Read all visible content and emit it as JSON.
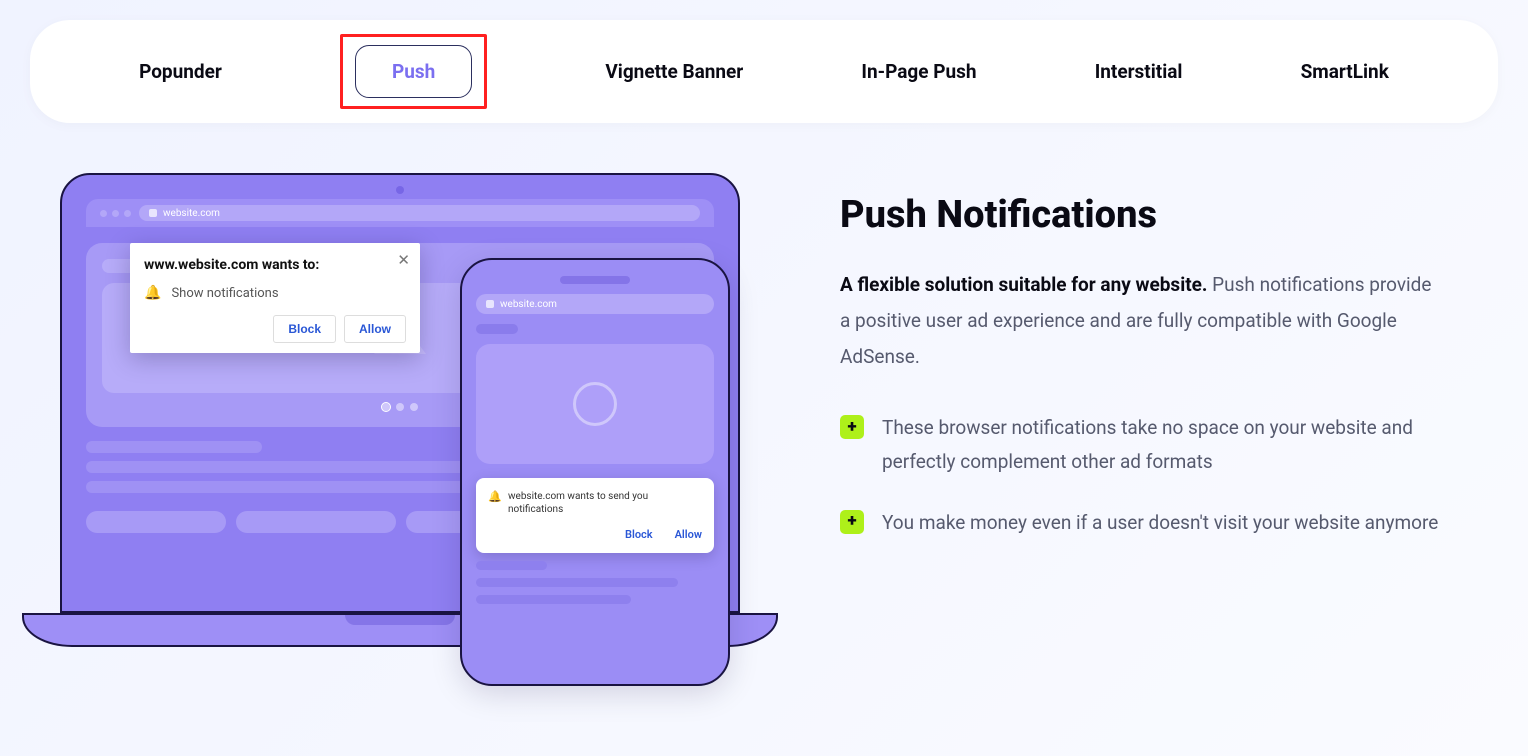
{
  "tabs": {
    "items": [
      {
        "label": "Popunder",
        "active": false
      },
      {
        "label": "Push",
        "active": true
      },
      {
        "label": "Vignette Banner",
        "active": false
      },
      {
        "label": "In-Page Push",
        "active": false
      },
      {
        "label": "Interstitial",
        "active": false
      },
      {
        "label": "SmartLink",
        "active": false
      }
    ]
  },
  "illustration": {
    "browser_url": "website.com",
    "desktop_dialog": {
      "title": "www.website.com wants to:",
      "permission": "Show notifications",
      "block": "Block",
      "allow": "Allow"
    },
    "mobile_url": "website.com",
    "mobile_dialog": {
      "text": "website.com wants to send you notifications",
      "block": "Block",
      "allow": "Allow"
    }
  },
  "info": {
    "heading": "Push Notifications",
    "lead_bold": "A flexible solution suitable for any website.",
    "lead_rest": " Push notifications provide a positive user ad experience and are fully compatible with Google AdSense.",
    "bullets": [
      "These browser notifications take no space on your website and perfectly complement other ad formats",
      "You make money even if a user doesn't visit your website anymore"
    ]
  }
}
